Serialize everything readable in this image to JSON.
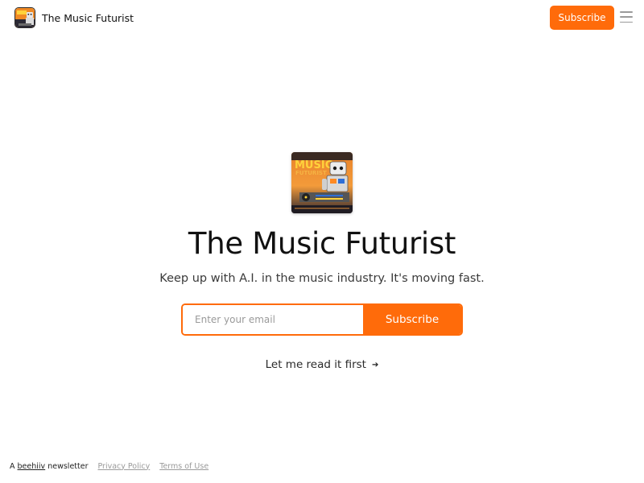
{
  "header": {
    "title": "The Music Futurist",
    "subscribe_label": "Subscribe",
    "menu_icon": "hamburger-menu-icon"
  },
  "hero": {
    "logo_text": "MUSIC",
    "title": "The Music Futurist",
    "tagline": "Keep up with A.I. in the music industry. It's moving fast."
  },
  "signup": {
    "email_placeholder": "Enter your email",
    "email_value": "",
    "subscribe_label": "Subscribe"
  },
  "read_first": {
    "label": "Let me read it first",
    "icon": "arrow-right-icon",
    "arrow": "➔"
  },
  "footer": {
    "prefix": "A",
    "platform": "beehiiv",
    "suffix": "newsletter",
    "privacy": "Privacy Policy",
    "terms": "Terms of Use"
  },
  "colors": {
    "accent": "#ff6b0a",
    "text": "#111111",
    "muted": "#9a9a9a"
  }
}
